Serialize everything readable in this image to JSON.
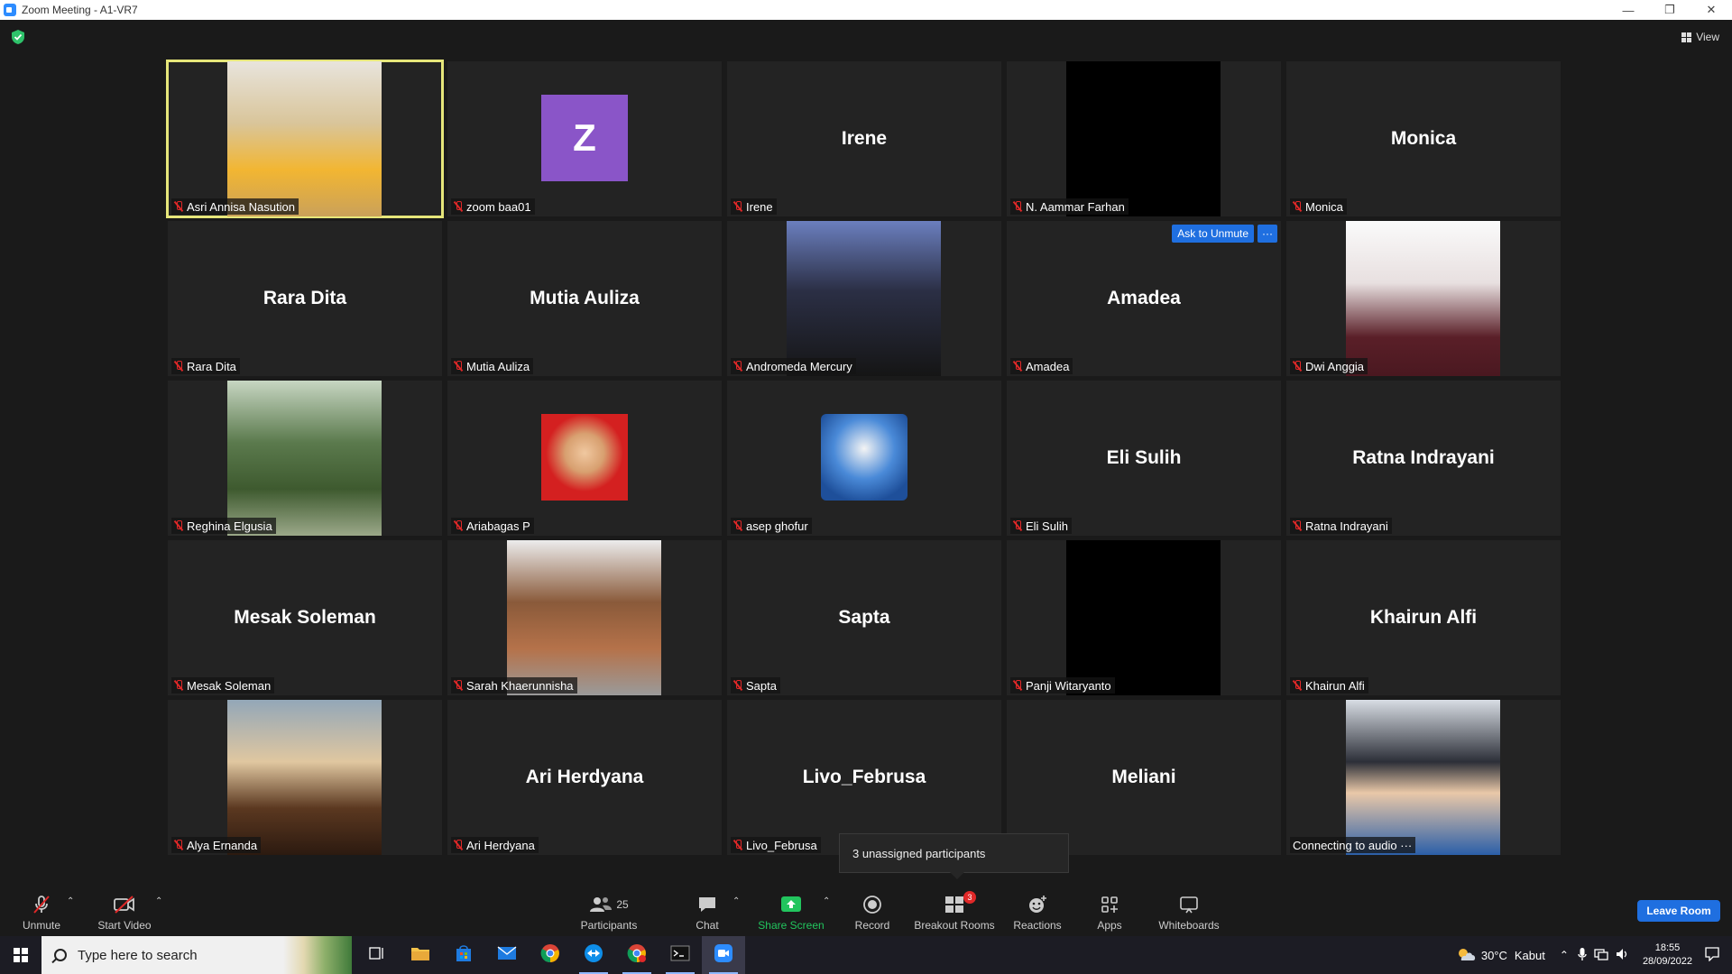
{
  "window": {
    "title": "Zoom Meeting - A1-VR7"
  },
  "top": {
    "view_label": "View"
  },
  "participants": [
    {
      "name": "Asri Annisa Nasution",
      "display": "photo",
      "active": true
    },
    {
      "name": "zoom baa01",
      "display": "avatar",
      "avatar_letter": "Z"
    },
    {
      "name": "Irene",
      "display": "name",
      "center_name": "Irene"
    },
    {
      "name": "N. Aammar Farhan",
      "display": "black"
    },
    {
      "name": "Monica",
      "display": "name",
      "center_name": "Monica"
    },
    {
      "name": "Rara Dita",
      "display": "name",
      "center_name": "Rara Dita"
    },
    {
      "name": "Mutia Auliza",
      "display": "name",
      "center_name": "Mutia Auliza"
    },
    {
      "name": "Andromeda Mercury",
      "display": "photo"
    },
    {
      "name": "Amadea",
      "display": "name",
      "center_name": "Amadea",
      "ask_unmute": "Ask to Unmute",
      "more": "···"
    },
    {
      "name": "Dwi Anggia",
      "display": "photo"
    },
    {
      "name": "Reghina Elgusia",
      "display": "photo"
    },
    {
      "name": "Ariabagas P",
      "display": "photo-square"
    },
    {
      "name": "asep ghofur",
      "display": "photo-square"
    },
    {
      "name": "Eli Sulih",
      "display": "name",
      "center_name": "Eli Sulih"
    },
    {
      "name": "Ratna Indrayani",
      "display": "name",
      "center_name": "Ratna Indrayani"
    },
    {
      "name": "Mesak Soleman",
      "display": "name",
      "center_name": "Mesak Soleman"
    },
    {
      "name": "Sarah Khaerunnisha",
      "display": "photo"
    },
    {
      "name": "Sapta",
      "display": "name",
      "center_name": "Sapta"
    },
    {
      "name": "Panji Witaryanto",
      "display": "black"
    },
    {
      "name": "Khairun Alfi",
      "display": "name",
      "center_name": "Khairun Alfi"
    },
    {
      "name": "Alya Ernanda",
      "display": "photo"
    },
    {
      "name": "Ari Herdyana",
      "display": "name",
      "center_name": "Ari Herdyana"
    },
    {
      "name": "Livo_Februsa",
      "display": "name",
      "center_name": "Livo_Februsa"
    },
    {
      "name": "",
      "display": "name",
      "center_name": "Meliani",
      "no_label": true
    },
    {
      "name": "Connecting to audio ···",
      "display": "photo",
      "no_mic": true
    }
  ],
  "popup": {
    "text": "3 unassigned participants"
  },
  "toolbar": {
    "unmute": "Unmute",
    "start_video": "Start Video",
    "participants": "Participants",
    "participants_count": "25",
    "chat": "Chat",
    "share_screen": "Share Screen",
    "record": "Record",
    "breakout_rooms": "Breakout Rooms",
    "breakout_badge": "3",
    "reactions": "Reactions",
    "apps": "Apps",
    "whiteboards": "Whiteboards",
    "leave_room": "Leave Room",
    "accent": "#1f6fe0",
    "share_color": "#22c55e"
  },
  "taskbar": {
    "search_placeholder": "Type here to search",
    "apps": [
      "task-view-icon",
      "file-explorer-icon",
      "store-icon",
      "mail-icon",
      "chrome-icon",
      "teamviewer-icon",
      "chrome-profile-icon",
      "terminal-icon",
      "zoom-icon"
    ],
    "weather_temp": "30°C",
    "weather_text": "Kabut",
    "time": "18:55",
    "date": "28/09/2022"
  }
}
